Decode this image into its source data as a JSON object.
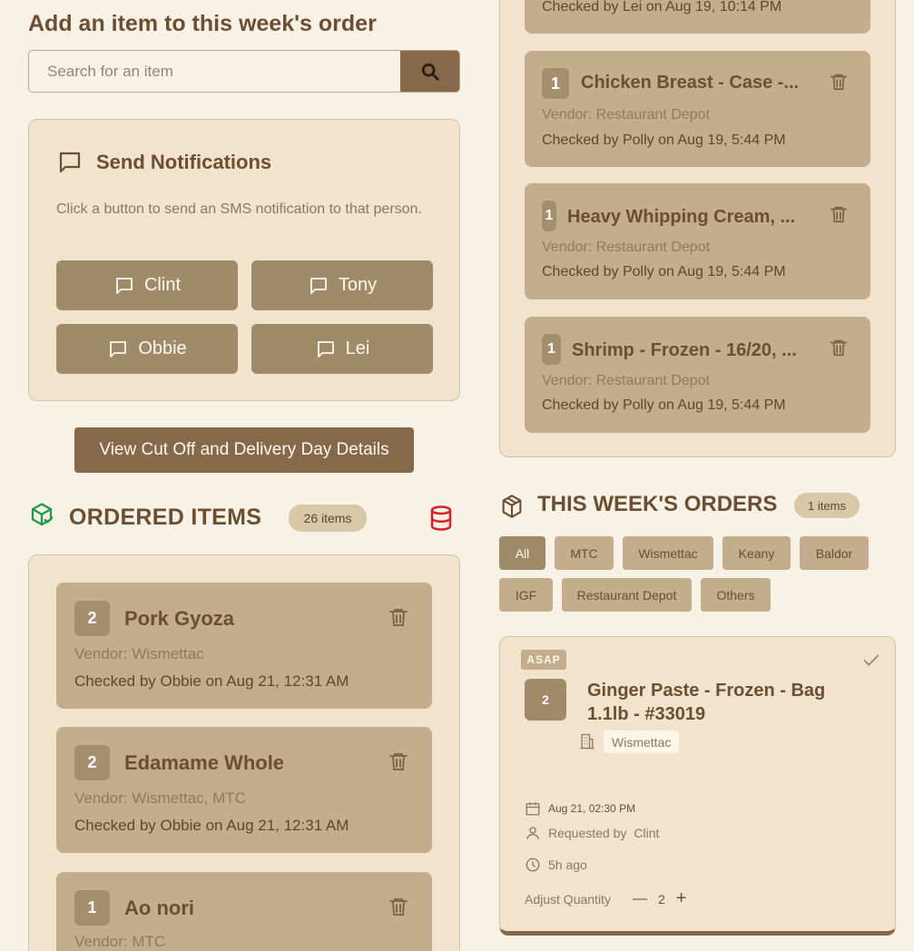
{
  "add_item": {
    "title": "Add an item to this week's order",
    "search_placeholder": "Search for an item"
  },
  "notifications": {
    "title": "Send Notifications",
    "description": "Click a button to send an SMS notification to that person.",
    "people": [
      "Clint",
      "Tony",
      "Obbie",
      "Lei"
    ]
  },
  "cutoff_button": "View Cut Off and Delivery Day Details",
  "ordered": {
    "title": "ORDERED ITEMS",
    "count_label": "26 items",
    "items": [
      {
        "qty": "2",
        "name": "Pork Gyoza",
        "vendor": "Vendor: Wismettac",
        "checked": "Checked by Obbie on Aug 21, 12:31 AM"
      },
      {
        "qty": "2",
        "name": "Edamame Whole",
        "vendor": "Vendor: Wismettac, MTC",
        "checked": "Checked by Obbie on Aug 21, 12:31 AM"
      },
      {
        "qty": "1",
        "name": "Ao nori",
        "vendor": "Vendor: MTC",
        "checked": ""
      }
    ]
  },
  "right_list": {
    "top_partial_checked": "Checked by Lei on Aug 19, 10:14 PM",
    "items": [
      {
        "qty": "1",
        "name": "Chicken Breast - Case -...",
        "vendor": "Vendor: Restaurant Depot",
        "checked": "Checked by Polly on Aug 19, 5:44 PM"
      },
      {
        "qty": "1",
        "name": "Heavy Whipping Cream, ...",
        "vendor": "Vendor: Restaurant Depot",
        "checked": "Checked by Polly on Aug 19, 5:44 PM"
      },
      {
        "qty": "1",
        "name": "Shrimp - Frozen - 16/20, ...",
        "vendor": "Vendor: Restaurant Depot",
        "checked": "Checked by Polly on Aug 19, 5:44 PM"
      }
    ]
  },
  "week_orders": {
    "title": "THIS WEEK'S ORDERS",
    "count_label": "1 items",
    "filters": [
      "All",
      "MTC",
      "Wismettac",
      "Keany",
      "Baldor",
      "IGF",
      "Restaurant Depot",
      "Others"
    ],
    "active_filter": "All",
    "order": {
      "priority": "ASAP",
      "qty": "2",
      "name": "Ginger Paste - Frozen - Bag 1.1lb - #33019",
      "vendor": "Wismettac",
      "date": "Aug 21, 02:30 PM",
      "requested_label": "Requested by",
      "requested_by": "Clint",
      "age": "5h ago",
      "adjust_label": "Adjust Quantity",
      "adjust_value": "2",
      "minus": "—",
      "plus": "+"
    }
  },
  "colors": {
    "background": "#f8f1e6",
    "panel": "#f1e3cc",
    "card": "#c3ad8c",
    "accent": "#86684b",
    "text": "#6b4f33",
    "green_icon": "#1f9a4a",
    "red_icon": "#d81e2a"
  }
}
